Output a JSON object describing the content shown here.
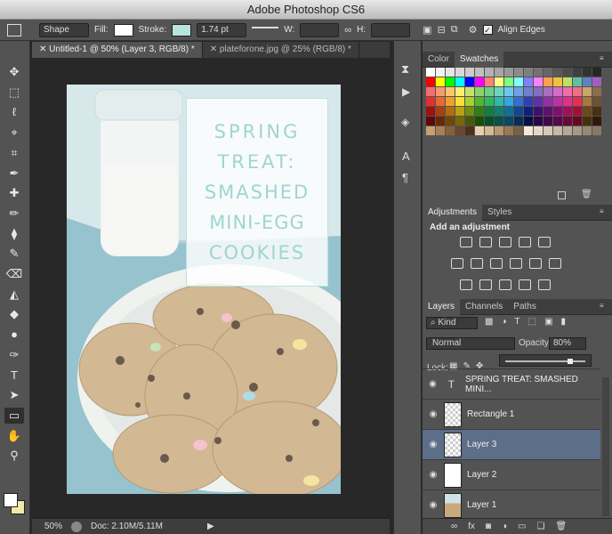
{
  "app": {
    "title": "Adobe Photoshop CS6"
  },
  "options_bar": {
    "mode": "Shape",
    "fill_label": "Fill:",
    "stroke_label": "Stroke:",
    "stroke_width": "1.74 pt",
    "w_label": "W:",
    "h_label": "H:",
    "align_edges_label": "Align Edges",
    "fill_color": "#ffffff",
    "stroke_color": "#b7e4e0"
  },
  "doc_tabs": [
    {
      "label": "Untitled-1 @ 50% (Layer 3, RGB/8) *",
      "active": true
    },
    {
      "label": "plateforone.jpg @ 25% (RGB/8) *",
      "active": false
    }
  ],
  "document": {
    "overlay_lines": [
      "SPRING",
      "TREAT:",
      "SMASHED",
      "MINI-EGG",
      "COOKIES"
    ],
    "overlay_text_color": "#9fd5d1"
  },
  "status": {
    "zoom": "50%",
    "doc_size": "Doc: 2.10M/5.11M"
  },
  "panels": {
    "swatch_tabs": [
      "Color",
      "Swatches"
    ],
    "adjustment_tabs": [
      "Adjustments",
      "Styles"
    ],
    "add_adjustment": "Add an adjustment",
    "layer_tabs": [
      "Layers",
      "Channels",
      "Paths"
    ],
    "kind_label": "Kind",
    "blend_mode": "Normal",
    "opacity_label": "Opacity:",
    "opacity_value": "80%",
    "lock_label": "Lock:",
    "layers": [
      {
        "name": "SPRING TREAT: SMASHED MINI...",
        "type": "text",
        "selected": false
      },
      {
        "name": "Rectangle 1",
        "type": "shape",
        "selected": false
      },
      {
        "name": "Layer 3",
        "type": "pixel",
        "selected": true
      },
      {
        "name": "Layer 2",
        "type": "pixel",
        "selected": false
      },
      {
        "name": "Layer 1",
        "type": "image",
        "selected": false
      }
    ]
  },
  "tools": [
    "move-tool",
    "marquee-tool",
    "lasso-tool",
    "quick-select-tool",
    "crop-tool",
    "eyedropper-tool",
    "healing-tool",
    "brush-tool",
    "stamp-tool",
    "history-brush-tool",
    "eraser-tool",
    "gradient-tool",
    "blur-tool",
    "dodge-tool",
    "pen-tool",
    "type-tool",
    "path-select-tool",
    "rectangle-tool",
    "hand-tool",
    "zoom-tool"
  ],
  "colors": {
    "foreground": "#ffffff",
    "background": "#f0e9a8",
    "selected_layer": "#5c6e88"
  }
}
